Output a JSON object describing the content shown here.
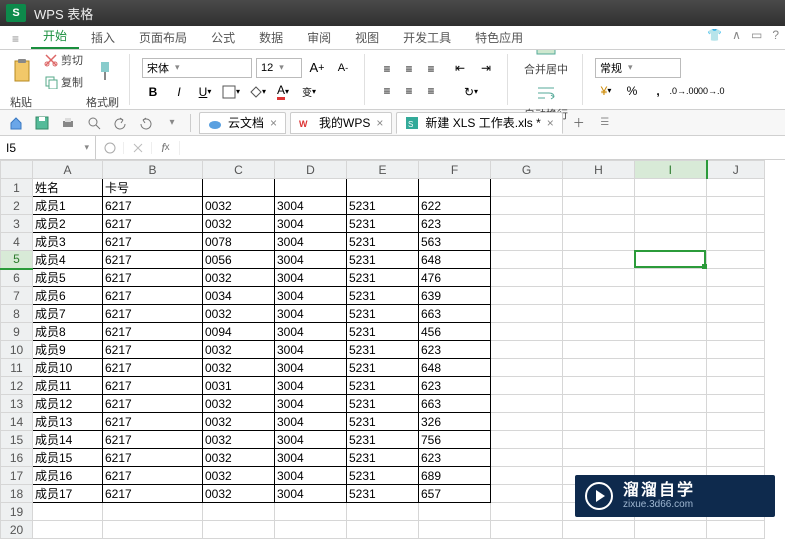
{
  "app": {
    "badge": "S",
    "title": "WPS 表格"
  },
  "menu": {
    "items": [
      {
        "label": "开始",
        "active": true
      },
      {
        "label": "插入"
      },
      {
        "label": "页面布局"
      },
      {
        "label": "公式"
      },
      {
        "label": "数据"
      },
      {
        "label": "审阅"
      },
      {
        "label": "视图"
      },
      {
        "label": "开发工具"
      },
      {
        "label": "特色应用"
      }
    ]
  },
  "ribbon": {
    "paste": "粘贴",
    "cut": "剪切",
    "copy": "复制",
    "format_painter": "格式刷",
    "font_name": "宋体",
    "font_size": "12",
    "merge_center": "合并居中",
    "wrap": "自动换行",
    "number_format": "常规"
  },
  "qa": {
    "labels": {}
  },
  "doc_tabs": [
    {
      "label": "云文档",
      "icon": "cloud",
      "active": false
    },
    {
      "label": "我的WPS",
      "icon": "wps",
      "active": false
    },
    {
      "label": "新建 XLS 工作表.xls *",
      "icon": "xls",
      "active": true
    }
  ],
  "namebox": "I5",
  "columns": [
    "A",
    "B",
    "C",
    "D",
    "E",
    "F",
    "G",
    "H",
    "I",
    "J"
  ],
  "selected": {
    "row": 5,
    "col": "I",
    "colIndex": 8
  },
  "table": {
    "header": [
      "姓名",
      "卡号",
      "",
      "",
      "",
      ""
    ],
    "rows": [
      [
        "成员1",
        "6217",
        "0032",
        "3004",
        "5231",
        "622"
      ],
      [
        "成员2",
        "6217",
        "0032",
        "3004",
        "5231",
        "623"
      ],
      [
        "成员3",
        "6217",
        "0078",
        "3004",
        "5231",
        "563"
      ],
      [
        "成员4",
        "6217",
        "0056",
        "3004",
        "5231",
        "648"
      ],
      [
        "成员5",
        "6217",
        "0032",
        "3004",
        "5231",
        "476"
      ],
      [
        "成员6",
        "6217",
        "0034",
        "3004",
        "5231",
        "639"
      ],
      [
        "成员7",
        "6217",
        "0032",
        "3004",
        "5231",
        "663"
      ],
      [
        "成员8",
        "6217",
        "0094",
        "3004",
        "5231",
        "456"
      ],
      [
        "成员9",
        "6217",
        "0032",
        "3004",
        "5231",
        "623"
      ],
      [
        "成员10",
        "6217",
        "0032",
        "3004",
        "5231",
        "648"
      ],
      [
        "成员11",
        "6217",
        "0031",
        "3004",
        "5231",
        "623"
      ],
      [
        "成员12",
        "6217",
        "0032",
        "3004",
        "5231",
        "663"
      ],
      [
        "成员13",
        "6217",
        "0032",
        "3004",
        "5231",
        "326"
      ],
      [
        "成员14",
        "6217",
        "0032",
        "3004",
        "5231",
        "756"
      ],
      [
        "成员15",
        "6217",
        "0032",
        "3004",
        "5231",
        "623"
      ],
      [
        "成员16",
        "6217",
        "0032",
        "3004",
        "5231",
        "689"
      ],
      [
        "成员17",
        "6217",
        "0032",
        "3004",
        "5231",
        "657"
      ]
    ]
  },
  "watermark": {
    "main": "溜溜自学",
    "sub": "zixue.3d66.com"
  }
}
